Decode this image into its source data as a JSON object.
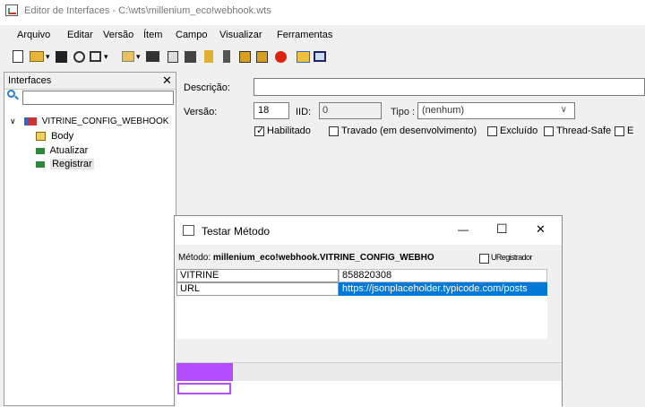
{
  "window": {
    "title": "Editor de Interfaces - C:\\wts\\millenium_eco!webhook.wts"
  },
  "menu": [
    "Arquivo",
    "Editar",
    "Versão",
    "Ítem",
    "Campo",
    "Visualizar",
    "Ferramentas"
  ],
  "toolbar_icons": [
    "new-doc-icon",
    "open-folder-icon",
    "save-icon",
    "search-icon",
    "view-icon",
    "add-item-icon",
    "edit-item-icon",
    "copy-icon",
    "paste-icon",
    "pin-icon",
    "filter-icon",
    "import-icon",
    "export-icon",
    "refresh-icon",
    "compare-icon",
    "grid-icon"
  ],
  "left_panel": {
    "title": "Interfaces",
    "close": "✕",
    "search_value": "",
    "tree": {
      "root": "VITRINE_CONFIG_WEBHOOK",
      "children": [
        "Body",
        "Atualizar",
        "Registrar"
      ],
      "selected": "Registrar"
    }
  },
  "form": {
    "descricao_label": "Descrição:",
    "descricao_value": "",
    "versao_label": "Versão:",
    "versao_value": "18",
    "iid_label": "IID:",
    "iid_value": "0",
    "tipo_label": "Tipo :",
    "tipo_value": "(nenhum)",
    "checkboxes": [
      {
        "label": "Habilitado",
        "checked": true
      },
      {
        "label": "Travado (em desenvolvimento)",
        "checked": false
      },
      {
        "label": "Excluído",
        "checked": false
      },
      {
        "label": "Thread-Safe",
        "checked": false
      },
      {
        "label": "E",
        "checked": false
      }
    ]
  },
  "dialog": {
    "title": "Testar Método",
    "minimize": "—",
    "maximize": "☐",
    "close": "✕",
    "metodo_label": "Método:",
    "metodo_value": "millenium_eco!webhook.VITRINE_CONFIG_WEBHO",
    "registrador_label": "URegistrador",
    "params": [
      {
        "name": "VITRINE",
        "value": "858820308",
        "selected": false
      },
      {
        "name": "URL",
        "value": "https://jsonplaceholder.typicode.com/posts",
        "selected": true
      }
    ],
    "accent_color": "#b44dff"
  }
}
